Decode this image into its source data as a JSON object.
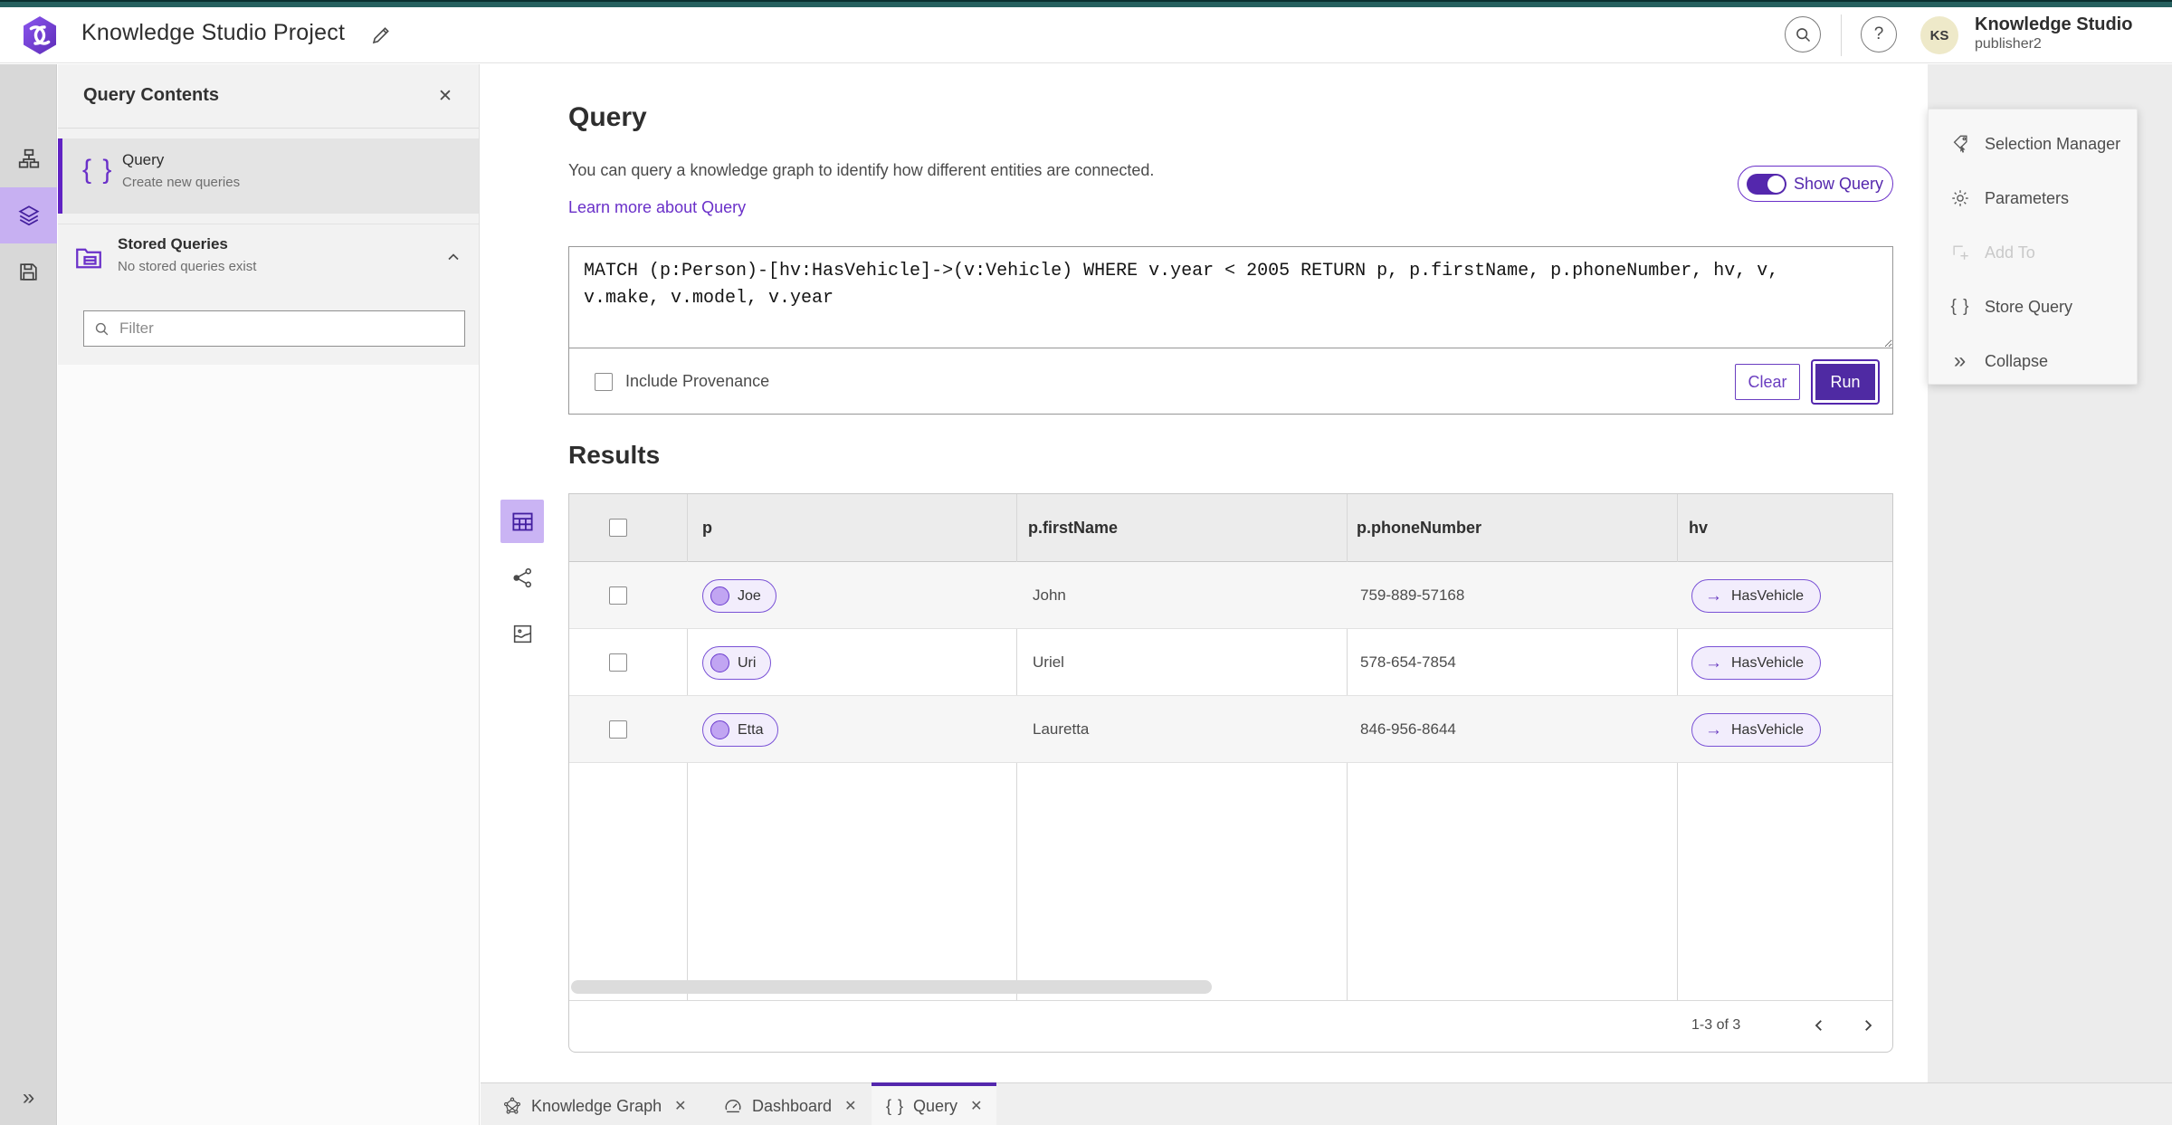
{
  "app": {
    "title": "Knowledge Studio Project"
  },
  "account": {
    "initials": "KS",
    "name": "Knowledge Studio",
    "role": "publisher2"
  },
  "contents_panel": {
    "title": "Query Contents",
    "query_item": {
      "label": "Query",
      "description": "Create new queries"
    },
    "stored_item": {
      "label": "Stored Queries",
      "description": "No stored queries exist"
    },
    "filter_placeholder": "Filter"
  },
  "query_section": {
    "title": "Query",
    "description": "You can query a knowledge graph to identify how different entities are connected.",
    "learn_more_link": "Learn more about Query",
    "show_query_label": "Show Query",
    "query_text": "MATCH (p:Person)-[hv:HasVehicle]->(v:Vehicle) WHERE v.year < 2005 RETURN p, p.firstName, p.phoneNumber, hv, v,\nv.make, v.model, v.year",
    "include_provenance_label": "Include Provenance",
    "clear_label": "Clear",
    "run_label": "Run"
  },
  "results": {
    "title": "Results",
    "columns": [
      "p",
      "p.firstName",
      "p.phoneNumber",
      "hv"
    ],
    "rows": [
      {
        "p": "Joe",
        "firstName": "John",
        "phoneNumber": "759-889-57168",
        "hv": "HasVehicle"
      },
      {
        "p": "Uri",
        "firstName": "Uriel",
        "phoneNumber": "578-654-7854",
        "hv": "HasVehicle"
      },
      {
        "p": "Etta",
        "firstName": "Lauretta",
        "phoneNumber": "846-956-8644",
        "hv": "HasVehicle"
      }
    ],
    "pagination": {
      "range_label": "1-3 of 3"
    }
  },
  "tools_panel": {
    "items": [
      {
        "label": "Selection Manager",
        "disabled": false
      },
      {
        "label": "Parameters",
        "disabled": false
      },
      {
        "label": "Add To",
        "disabled": true
      },
      {
        "label": "Store Query",
        "disabled": false
      },
      {
        "label": "Collapse",
        "disabled": false
      }
    ]
  },
  "bottom_tabs": [
    {
      "label": "Knowledge Graph",
      "active": false
    },
    {
      "label": "Dashboard",
      "active": false
    },
    {
      "label": "Query",
      "active": true
    }
  ],
  "icons": {
    "help": "?",
    "close": "✕",
    "braces": "{ }",
    "arrow_right": "→",
    "double_chevron_right": "»",
    "chip_names": [
      "Joe",
      "Uri",
      "Etta"
    ]
  },
  "colors": {
    "accent_purple": "#5427ad",
    "link_purple": "#6a30c9",
    "selected_light_purple": "#c7b0f2",
    "chip_background": "#f2edfc",
    "teal_band": "#26605f",
    "avatar_yellow": "#eee9c9"
  }
}
